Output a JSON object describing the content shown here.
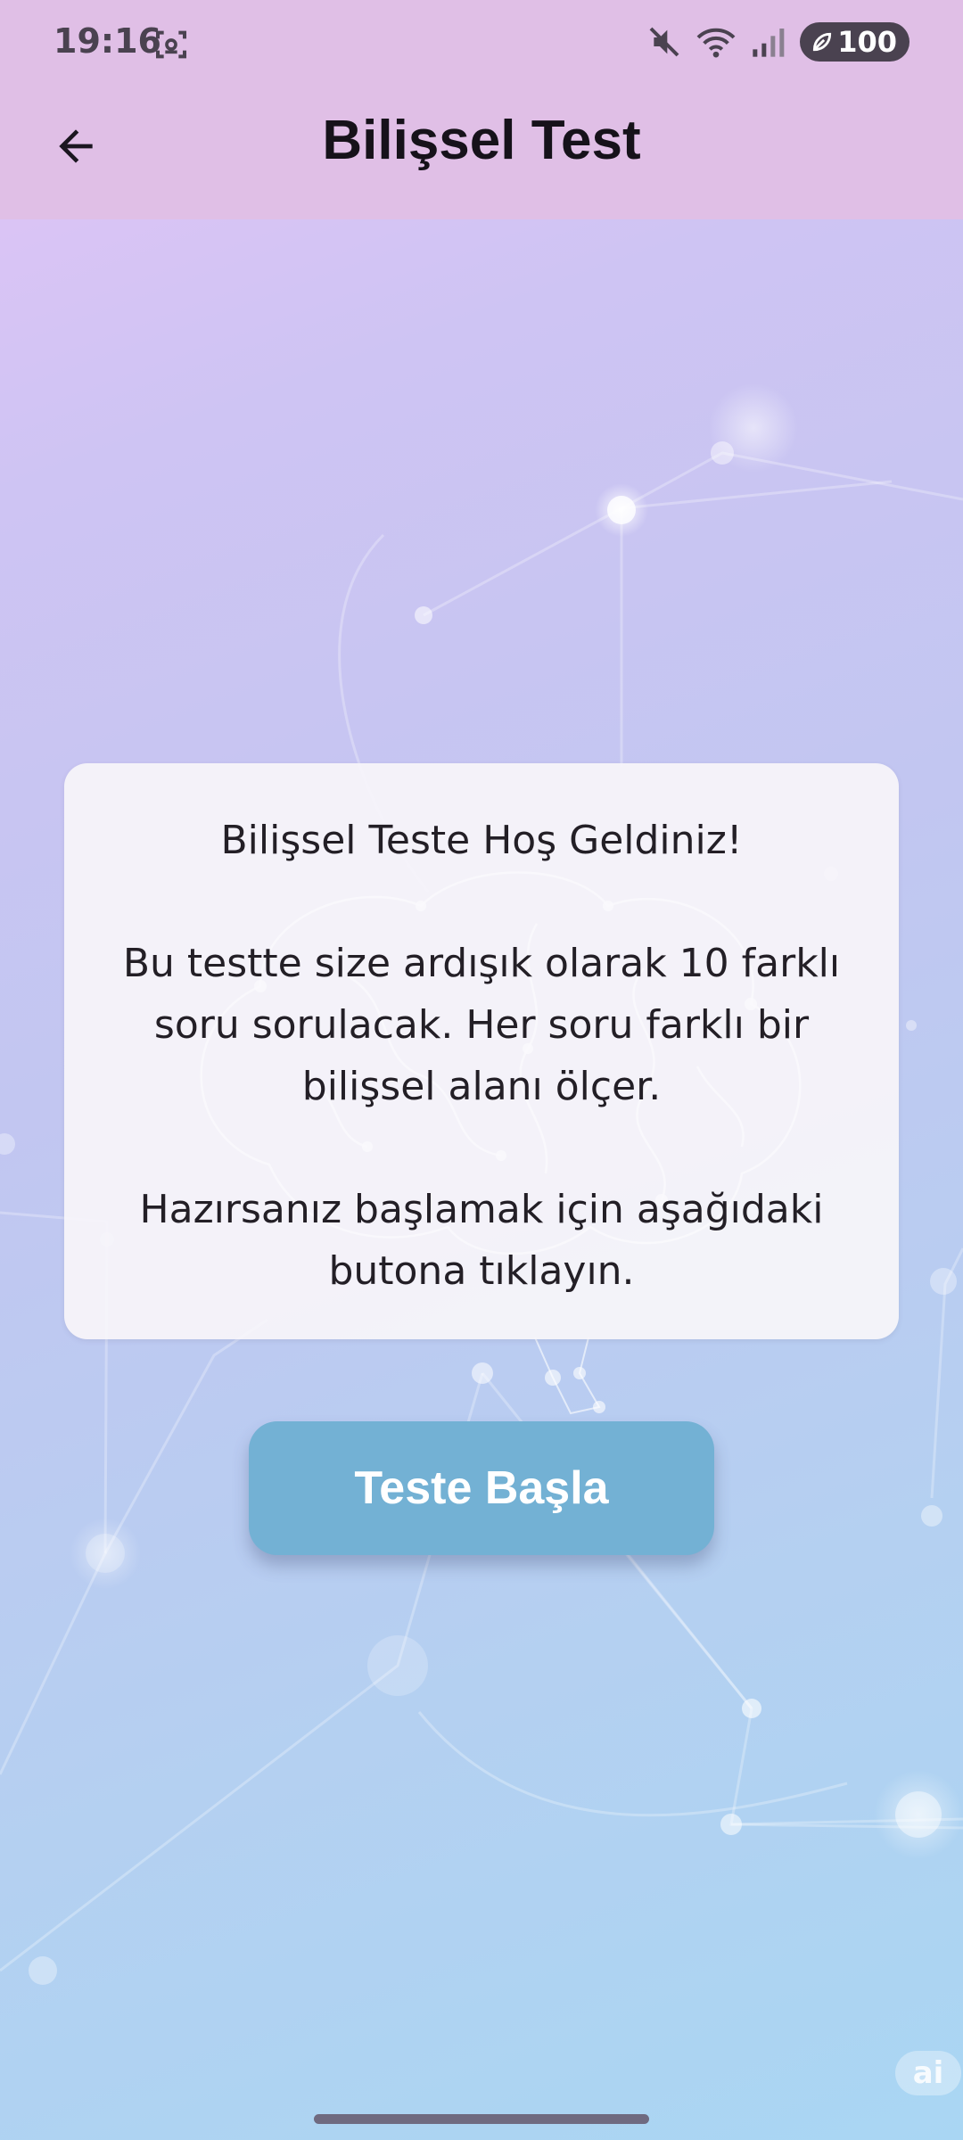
{
  "status_bar": {
    "time": "19:16",
    "battery_level": "100",
    "icons": [
      "screenshot-icon",
      "mute-icon",
      "wifi-icon",
      "signal-icon",
      "battery-saver-icon"
    ]
  },
  "app_bar": {
    "title": "Bilişsel Test",
    "back_icon": "arrow-left-icon"
  },
  "intro_card": {
    "heading": "Bilişsel Teste Hoş Geldiniz!",
    "description": "Bu testte size ardışık olarak 10 farklı soru sorulacak. Her soru farklı bir bilişsel alanı ölçer.",
    "instruction": "Hazırsanız başlamak için aşağıdaki butona tıklayın."
  },
  "start_button": {
    "label": "Teste Başla"
  },
  "corner_badge": {
    "label": "ai"
  },
  "colors": {
    "app_bar_bg": "#e0bfe6",
    "button_bg": "#73b1d4",
    "card_bg": "#f7f5fa",
    "gradient_top": "#e4c4f7",
    "gradient_bottom": "#a9d6f3"
  }
}
